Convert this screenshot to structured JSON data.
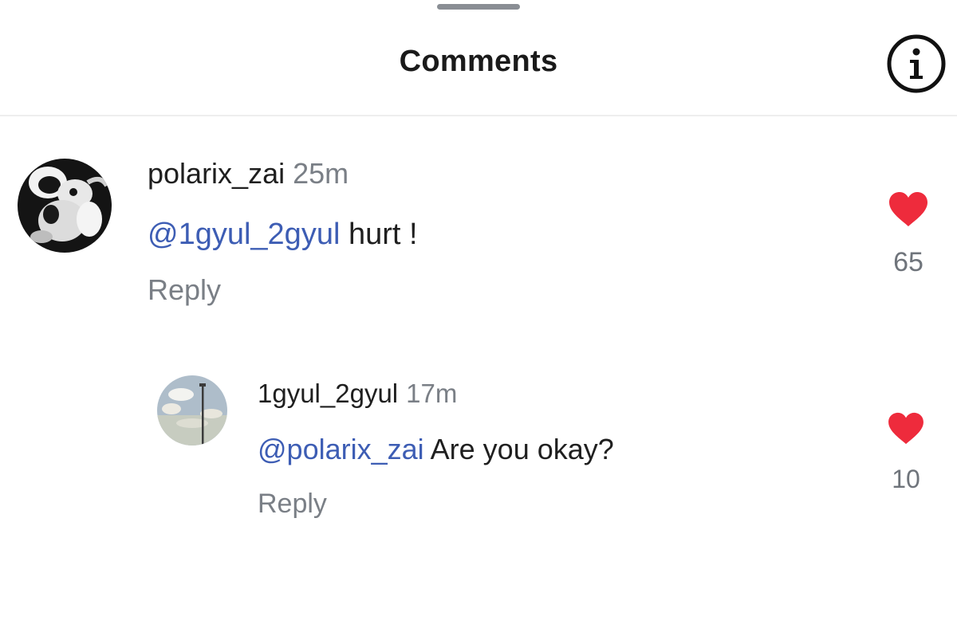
{
  "header": {
    "title": "Comments",
    "info_icon": "info-circle-icon"
  },
  "comments": [
    {
      "username": "polarix_zai",
      "time": "25m",
      "mention": "@1gyul_2gyul",
      "text": " hurt !",
      "reply_label": "Reply",
      "likes": "65",
      "avatar": "cartoon-mouse-avatar"
    },
    {
      "username": "1gyul_2gyul",
      "time": "17m",
      "mention": "@polarix_zai",
      "text": " Are you okay?",
      "reply_label": "Reply",
      "likes": "10",
      "avatar": "sky-lamppost-avatar"
    }
  ],
  "colors": {
    "mention": "#3d5db4",
    "heart": "#ee2b3c",
    "muted": "#7a7f86",
    "text": "#1f1f1f"
  }
}
